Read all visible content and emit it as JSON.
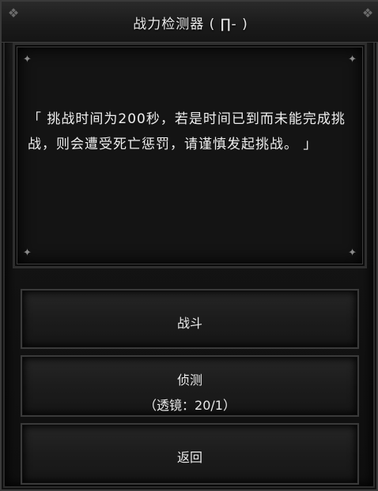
{
  "dialog": {
    "title": "战力检测器 ( ∏- )",
    "message": "「 挑战时间为200秒，若是时间已到而未能完成挑战，则会遭受死亡惩罚，请谨慎发起挑战。 」"
  },
  "buttons": {
    "fight_label": "战斗",
    "detect_label": "侦测",
    "detect_sub": "（透镜：20/1）",
    "back_label": "返回"
  },
  "icons": {
    "panel_corner": "sparkle-icon",
    "frame_corner": "ornament-icon"
  },
  "colors": {
    "background": "#0b0b0b",
    "panel": "#141414",
    "text": "#efefef",
    "border": "#3a3a3a"
  }
}
